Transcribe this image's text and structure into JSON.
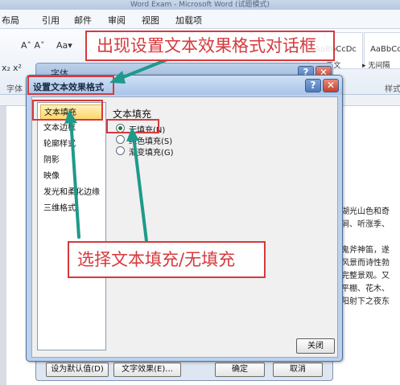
{
  "window": {
    "title": "Word Exam - Microsoft Word (试题模式)"
  },
  "menu": {
    "tabs": [
      "布局",
      "引用",
      "邮件",
      "审阅",
      "视图",
      "加载项"
    ]
  },
  "ribbon": {
    "font_grow": "A˄ A˅",
    "change_case": "Aa▾",
    "font_dialog_chip": "字体",
    "group_font": "字体",
    "group_styles": "样式",
    "subscript": "x₂",
    "superscript": "x²",
    "style_emphasis": "AaBbCcDc",
    "style_normal": "AaBbCcDc",
    "style_body_label": "▸ 正文",
    "style_nospacing_label": "▸ 无间隔"
  },
  "document": {
    "lines": [
      "湖光山色和奇",
      "涧、听涨季、",
      "鬼斧神笛，遂",
      "风景而诗性勃",
      "完整景观。又",
      "平棚、花木、",
      "阳射下之夜东"
    ]
  },
  "font_dialog": {
    "title": "字体",
    "buttons": {
      "set_default": "设为默认值(D)",
      "text_effects": "文字效果(E)...",
      "ok": "确定",
      "cancel": "取消"
    }
  },
  "text_effects_dialog": {
    "title": "设置文本效果格式",
    "categories": [
      "文本填充",
      "文本边框",
      "轮廓样式",
      "阴影",
      "映像",
      "发光和柔化边缘",
      "三维格式"
    ],
    "selected_category": "文本填充",
    "section_title": "文本填充",
    "options": [
      {
        "label": "无填充(N)",
        "checked": true
      },
      {
        "label": "纯色填充(S)",
        "checked": false
      },
      {
        "label": "渐变填充(G)",
        "checked": false
      }
    ],
    "help_glyph": "?",
    "close_glyph": "✕",
    "close_button": "关闭"
  },
  "annotations": {
    "dialog_callout": "出现设置文本效果格式对话框",
    "fill_callout": "选择文本填充/无填充",
    "highlight_color": "#d6393d",
    "arrow_color": "#1e9a8a"
  }
}
